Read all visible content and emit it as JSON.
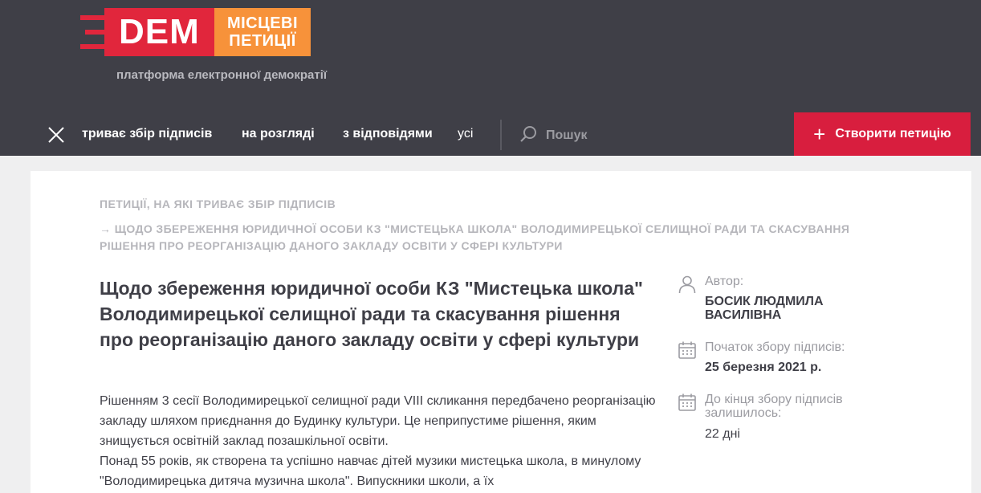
{
  "logo": {
    "dem": "DEM",
    "sub_line1": "МІСЦЕВІ",
    "sub_line2": "ПЕТИЦІЇ",
    "tagline": "платформа електронної демократії"
  },
  "nav": {
    "items": [
      "триває збір підписів",
      "на розгляді",
      "з відповідями",
      "усі"
    ],
    "search_label": "Пошук",
    "create_button": "Створити петицію"
  },
  "breadcrumbs": {
    "parent": "ПЕТИЦІЇ, НА ЯКІ ТРИВАЄ ЗБІР ПІДПИСІВ",
    "current": "→ ЩОДО ЗБЕРЕЖЕННЯ ЮРИДИЧНОЇ ОСОБИ КЗ \"МИСТЕЦЬКА ШКОЛА\" ВОЛОДИМИРЕЦЬКОЇ СЕЛИЩНОЇ РАДИ ТА СКАСУВАННЯ РІШЕННЯ ПРО РЕОРГАНІЗАЦІЮ ДАНОГО ЗАКЛАДУ ОСВІТИ У СФЕРІ КУЛЬТУРИ"
  },
  "petition": {
    "title": "Щодо збереження юридичної особи КЗ \"Мистецька школа\" Володимирецької селищної ради та скасування рішення про реорганізацію даного закладу освіти у сфері культури",
    "paragraph1": "Рішенням 3 сесії Володимирецької селищної ради VIII скликання передбачено реорганізацію закладу шляхом приєднання до Будинку культури. Це неприпустиме рішення, яким знищується освітній заклад позашкільної освіти.",
    "paragraph2": "Понад 55 років, як створена та успішно навчає дітей музики мистецька школа, в минулому \"Володимирецька дитяча музична школа\". Випускники школи, а їх"
  },
  "meta": {
    "author_label": "Автор:",
    "author_value": "БОСИК ЛЮДМИЛА ВАСИЛІВНА",
    "start_label": "Початок збору підписів:",
    "start_value": "25 березня 2021 р.",
    "remaining_label": "До кінця збору підписів залишилось:",
    "remaining_value": "22 дні"
  },
  "colors": {
    "header_bg": "#3f3f47",
    "brand_red": "#e1263c",
    "brand_orange": "#f7923a",
    "create_button_bg": "#d81e3e"
  }
}
